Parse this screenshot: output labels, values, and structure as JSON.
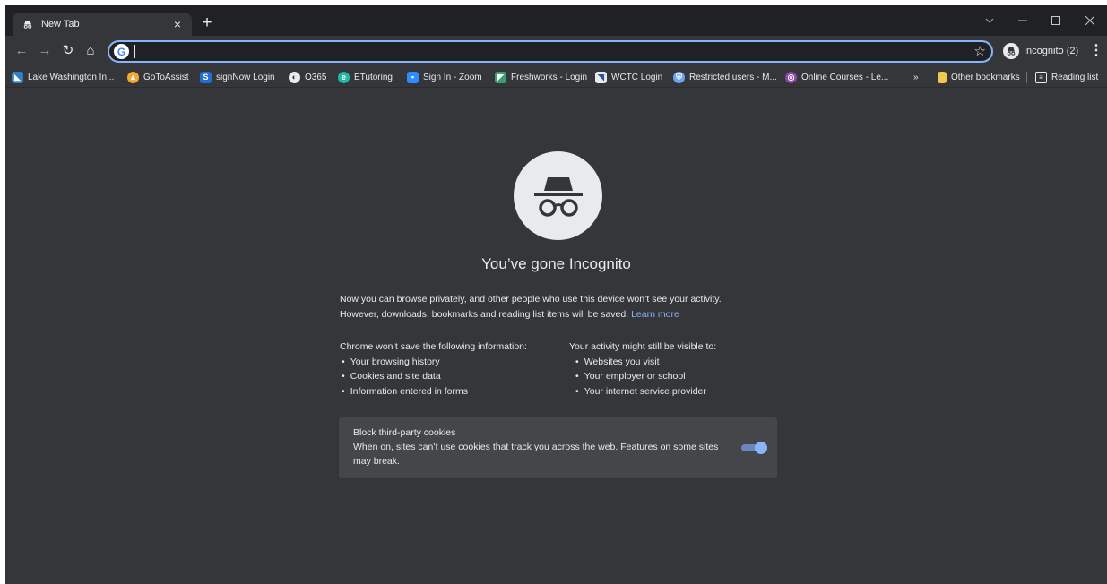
{
  "tab": {
    "title": "New Tab",
    "icon": "incognito-icon",
    "close_label": "×",
    "new_tab_label": "+"
  },
  "window_controls": [
    "chevron-down-icon",
    "minimize-icon",
    "maximize-icon",
    "close-icon"
  ],
  "toolbar": {
    "omnibox_value": "",
    "incognito_label": "Incognito (2)"
  },
  "bookmarks": [
    {
      "label": "Lake Washington In...",
      "icon": "lake-washington-icon",
      "color": "#2f7fc1"
    },
    {
      "label": "GoToAssist",
      "icon": "gotoassist-icon",
      "color": "#f2a833"
    },
    {
      "label": "signNow Login",
      "icon": "signnow-icon",
      "color": "#1f6fd6"
    },
    {
      "label": "O365",
      "icon": "globe-icon",
      "color": "#e8eaed"
    },
    {
      "label": "ETutoring",
      "icon": "etutoring-icon",
      "color": "#1fb9a6"
    },
    {
      "label": "Sign In - Zoom",
      "icon": "zoom-icon",
      "color": "#2d8cff"
    },
    {
      "label": "Freshworks - Login",
      "icon": "freshworks-icon",
      "color": "#3a9e6f"
    },
    {
      "label": "WCTC Login",
      "icon": "wctc-icon",
      "color": "#e8eaed"
    },
    {
      "label": "Restricted users - M...",
      "icon": "shield-icon",
      "color": "#6ea4f0"
    },
    {
      "label": "Online Courses - Le...",
      "icon": "online-courses-icon",
      "color": "#8e44ad"
    }
  ],
  "bookmarks_overflow": "»",
  "other_bookmarks": "Other bookmarks",
  "reading_list": "Reading list",
  "page": {
    "heading": "You’ve gone Incognito",
    "intro_line1": "Now you can browse privately, and other people who use this device won’t see your activity.",
    "intro_line2": "However, downloads, bookmarks and reading list items will be saved.",
    "learn_more": "Learn more",
    "not_saved_title": "Chrome won’t save the following information:",
    "not_saved": [
      "Your browsing history",
      "Cookies and site data",
      "Information entered in forms"
    ],
    "visible_title": "Your activity might still be visible to:",
    "visible": [
      "Websites you visit",
      "Your employer or school",
      "Your internet service provider"
    ],
    "cookies_title": "Block third-party cookies",
    "cookies_desc": "When on, sites can’t use cookies that track you across the web. Features on some sites may break.",
    "cookies_toggle_on": true
  },
  "colors": {
    "frame": "#202124",
    "background": "#35363a",
    "accent": "#8ab4f8",
    "card": "#45464a"
  }
}
